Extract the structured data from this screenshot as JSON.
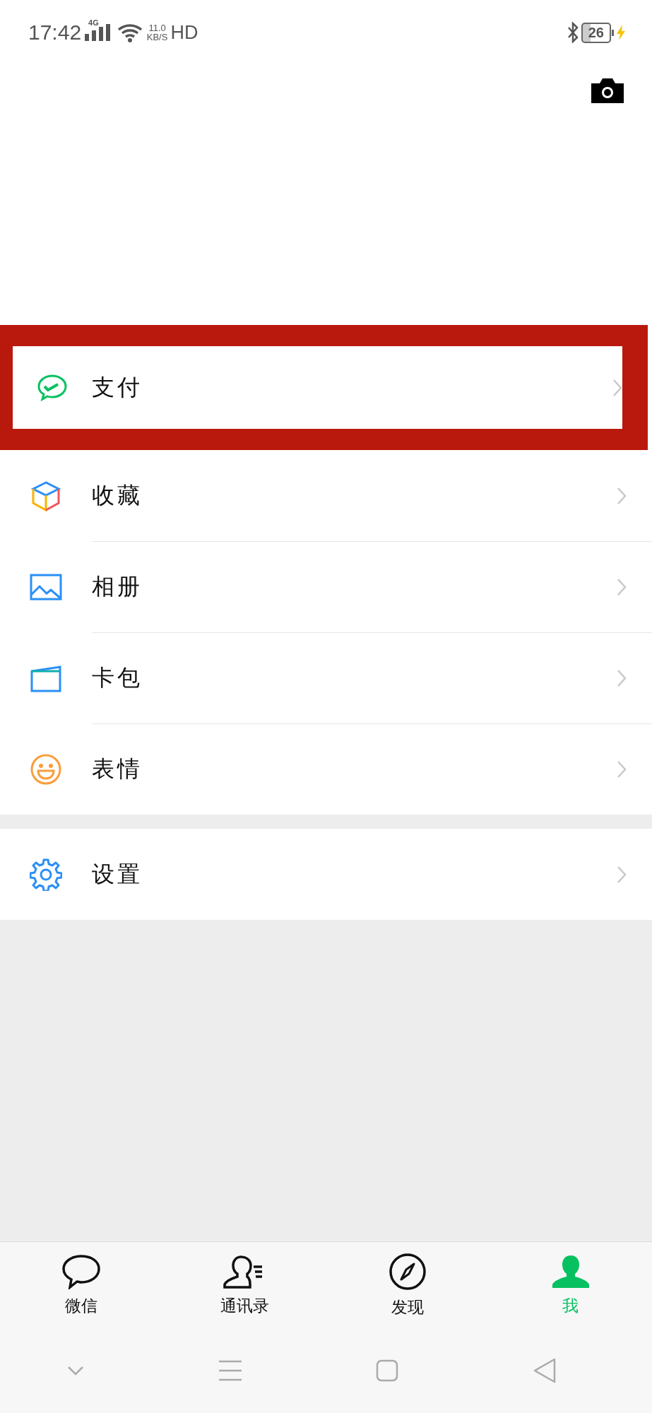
{
  "status_bar": {
    "time": "17:42",
    "network": "4G",
    "speed_value": "11.0",
    "speed_unit": "KB/S",
    "hd": "HD",
    "battery": "26",
    "charging": true
  },
  "menu_groups": [
    {
      "items": [
        {
          "label": "支付",
          "kind": "pay",
          "highlighted": true
        }
      ]
    },
    {
      "items": [
        {
          "label": "收藏",
          "kind": "favorites",
          "highlighted": false
        },
        {
          "label": "相册",
          "kind": "album",
          "highlighted": false
        },
        {
          "label": "卡包",
          "kind": "cards",
          "highlighted": false
        },
        {
          "label": "表情",
          "kind": "stickers",
          "highlighted": false
        }
      ]
    },
    {
      "items": [
        {
          "label": "设置",
          "kind": "settings",
          "highlighted": false
        }
      ]
    }
  ],
  "tabs": [
    {
      "label": "微信",
      "kind": "chats",
      "selected": false
    },
    {
      "label": "通讯录",
      "kind": "contacts",
      "selected": false
    },
    {
      "label": "发现",
      "kind": "discover",
      "selected": false
    },
    {
      "label": "我",
      "kind": "me",
      "selected": true
    }
  ]
}
